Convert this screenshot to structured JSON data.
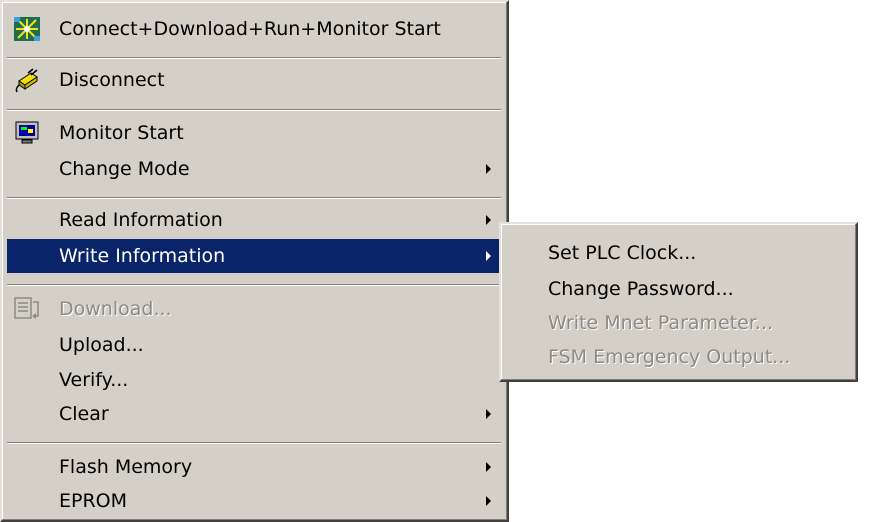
{
  "main_menu": {
    "items": [
      {
        "label": "Connect+Download+Run+Monitor Start",
        "icon": "connect-run-icon",
        "submenu": false
      },
      {
        "label": "Disconnect",
        "icon": "disconnect-plug-icon",
        "submenu": false
      },
      {
        "label": "Monitor Start",
        "icon": "monitor-icon",
        "submenu": false
      },
      {
        "label": "Change Mode",
        "icon": "",
        "submenu": true
      },
      {
        "label": "Read Information",
        "icon": "",
        "submenu": true
      },
      {
        "label": "Write Information",
        "icon": "",
        "submenu": true,
        "selected": true
      },
      {
        "label": "Download...",
        "icon": "download-icon",
        "submenu": false,
        "disabled": true
      },
      {
        "label": "Upload...",
        "icon": "",
        "submenu": false
      },
      {
        "label": "Verify...",
        "icon": "",
        "submenu": false
      },
      {
        "label": "Clear",
        "icon": "",
        "submenu": true
      },
      {
        "label": "Flash Memory",
        "icon": "",
        "submenu": true
      },
      {
        "label": "EPROM",
        "icon": "",
        "submenu": true
      }
    ]
  },
  "sub_menu": {
    "items": [
      {
        "label": "Set PLC Clock...",
        "disabled": false
      },
      {
        "label": "Change Password...",
        "disabled": false
      },
      {
        "label": "Write Mnet Parameter...",
        "disabled": true
      },
      {
        "label": "FSM Emergency Output...",
        "disabled": true
      }
    ]
  },
  "colors": {
    "menu_bg": "#d4d0c8",
    "highlight": "#0a246a",
    "disabled_text": "#8c8a86"
  }
}
